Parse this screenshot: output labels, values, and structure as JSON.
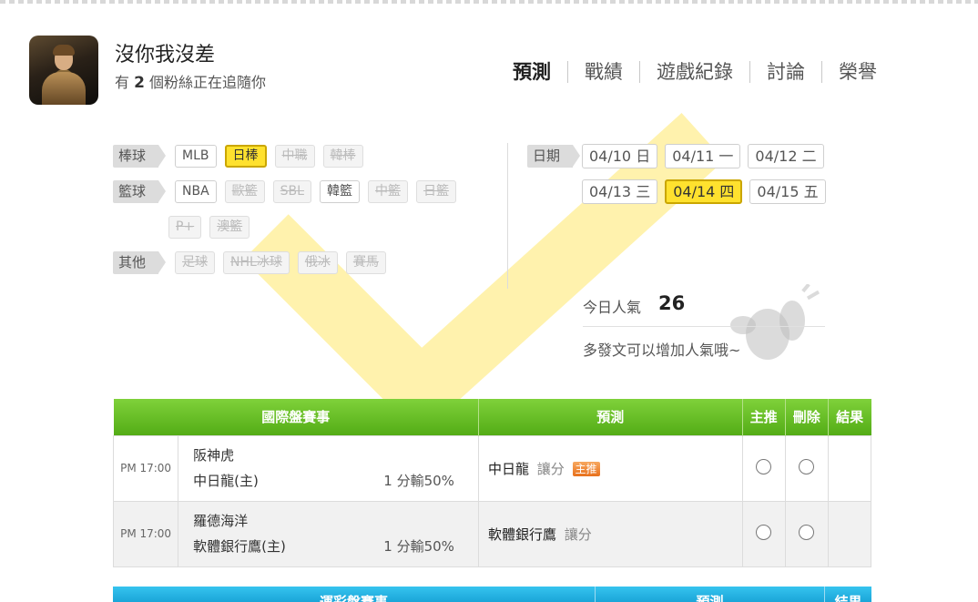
{
  "profile": {
    "name": "沒你我沒差",
    "fans_prefix": "有",
    "fans_count": "2",
    "fans_suffix": "個粉絲正在追隨你"
  },
  "nav": {
    "tabs": [
      {
        "label": "預測",
        "active": true
      },
      {
        "label": "戰績"
      },
      {
        "label": "遊戲紀錄"
      },
      {
        "label": "討論"
      },
      {
        "label": "榮譽"
      }
    ]
  },
  "categories": {
    "baseball": {
      "label": "棒球",
      "items": [
        "MLB",
        "日棒",
        "中職",
        "韓棒"
      ]
    },
    "basketball": {
      "label": "籃球",
      "items": [
        "NBA",
        "歐籃",
        "SBL",
        "韓籃",
        "中籃",
        "日籃",
        "P+",
        "澳籃"
      ]
    },
    "other": {
      "label": "其他",
      "items": [
        "足球",
        "NHL冰球",
        "俄冰",
        "賽馬"
      ]
    }
  },
  "dates": {
    "label": "日期",
    "items": [
      "04/10 日",
      "04/11 一",
      "04/12 二",
      "04/13 三",
      "04/14 四",
      "04/15 五"
    ],
    "selected": "04/14 四"
  },
  "popularity": {
    "label": "今日人氣",
    "value": "26",
    "note": "多發文可以增加人氣哦~"
  },
  "table": {
    "headers": {
      "game": "國際盤賽事",
      "prediction": "預測",
      "main": "主推",
      "delete": "刪除",
      "result": "結果"
    },
    "rows": [
      {
        "time": "PM 17:00",
        "away": "阪神虎",
        "home": "中日龍(主)",
        "odds": "1 分輸50%",
        "pred_team": "中日龍",
        "pred_kind": "讓分",
        "badge": "主推"
      },
      {
        "time": "PM 17:00",
        "away": "羅德海洋",
        "home": "軟體銀行鷹(主)",
        "odds": "1 分輸50%",
        "pred_team": "軟體銀行鷹",
        "pred_kind": "讓分"
      }
    ]
  },
  "table2": {
    "headers": {
      "game": "運彩盤賽事",
      "prediction": "預測",
      "result": "結果"
    }
  }
}
